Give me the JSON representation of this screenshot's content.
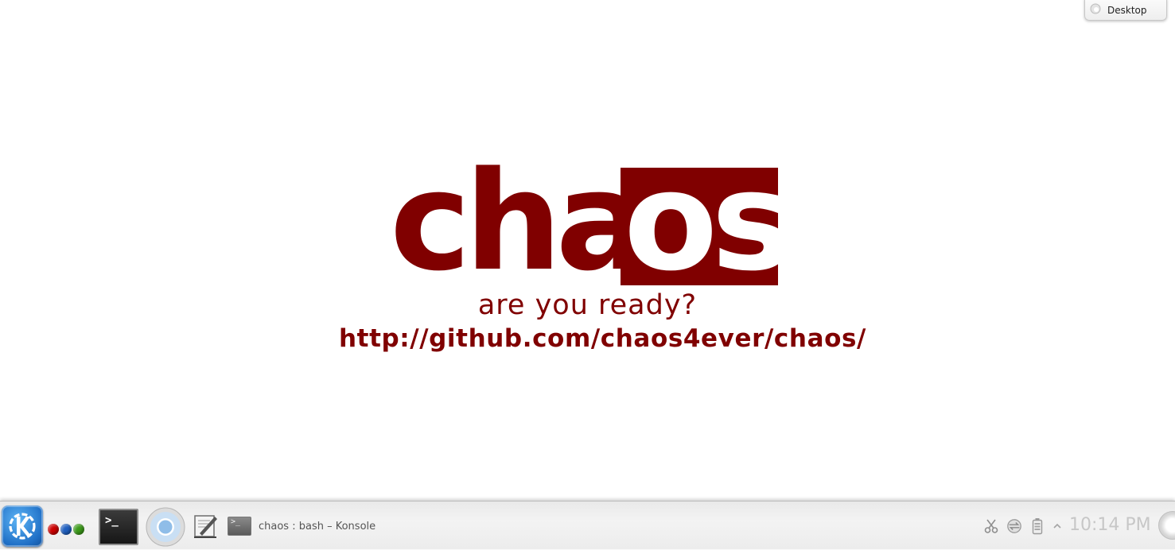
{
  "desktop": {
    "toolbox_label": "Desktop"
  },
  "wallpaper": {
    "logo_left": "cha",
    "logo_right": "os",
    "tagline": "are you ready?",
    "url": "http://github.com/chaos4ever/chaos/",
    "brand_color": "#800000"
  },
  "panel": {
    "kicker_icon": "kde-application-launcher-icon",
    "activity_dots": [
      "#cc0000",
      "#1f5fbf",
      "#3c9a1a"
    ],
    "launchers": [
      {
        "name": "konsole-launcher",
        "prompt": ">_"
      },
      {
        "name": "chromium-launcher"
      },
      {
        "name": "text-editor-launcher"
      }
    ],
    "task": {
      "label": "chaos : bash – Konsole",
      "prompt": ">_"
    },
    "tray": [
      "scissors-icon",
      "network-icon",
      "battery-icon",
      "tray-expand-arrow-icon"
    ],
    "clock": "10:14 PM"
  }
}
